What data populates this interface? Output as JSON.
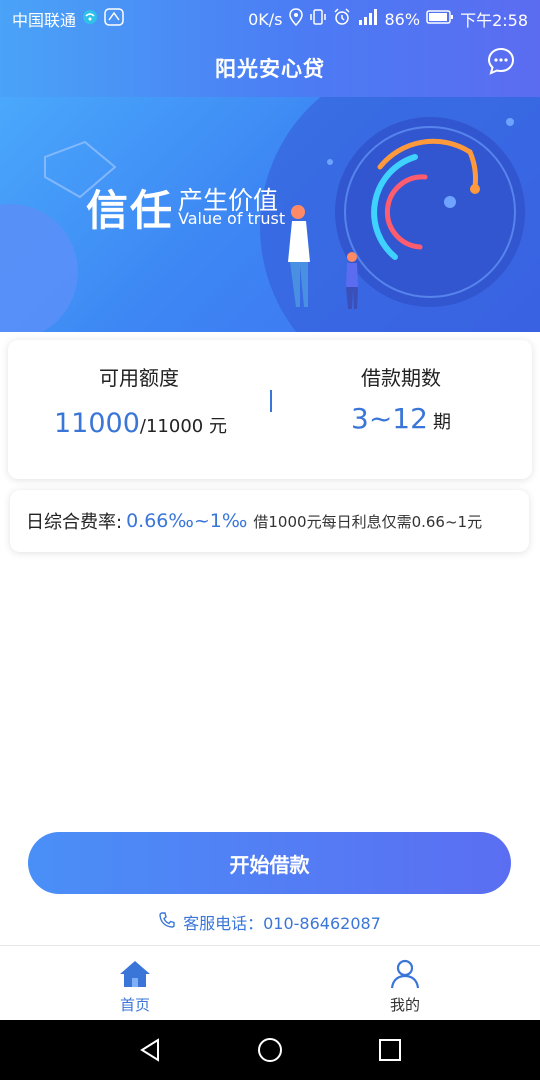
{
  "status_bar": {
    "carrier": "中国联通",
    "speed": "0K/s",
    "battery": "86%",
    "time": "下午2:58",
    "icons": [
      "wifi-calling-icon",
      "hd-icon",
      "location-icon",
      "vibrate-icon",
      "alarm-icon",
      "signal-icon",
      "battery-icon"
    ]
  },
  "header": {
    "title": "阳光安心贷",
    "chat_icon": "chat-bubble-icon"
  },
  "banner": {
    "main_text": "信任",
    "sub_text": "产生价值",
    "english_text": "Value of trust"
  },
  "loan_info": {
    "limit_label": "可用额度",
    "limit_available": "11000",
    "limit_total": "/11000 元",
    "term_label": "借款期数",
    "term_range": "3~12",
    "term_unit": "期"
  },
  "rate": {
    "label": "日综合费率:",
    "value": "0.66‰~1‰",
    "note": "借1000元每日利息仅需0.66~1元"
  },
  "cta": {
    "label": "开始借款"
  },
  "service": {
    "phone_icon": "phone-icon",
    "text": "客服电话：010-86462087"
  },
  "tabs": [
    {
      "label": "首页",
      "icon": "home-icon",
      "active": true
    },
    {
      "label": "我的",
      "icon": "user-icon",
      "active": false
    }
  ],
  "colors": {
    "accent": "#3a76d8",
    "header_start": "#4aa3f7",
    "header_end": "#5b6cf1"
  }
}
